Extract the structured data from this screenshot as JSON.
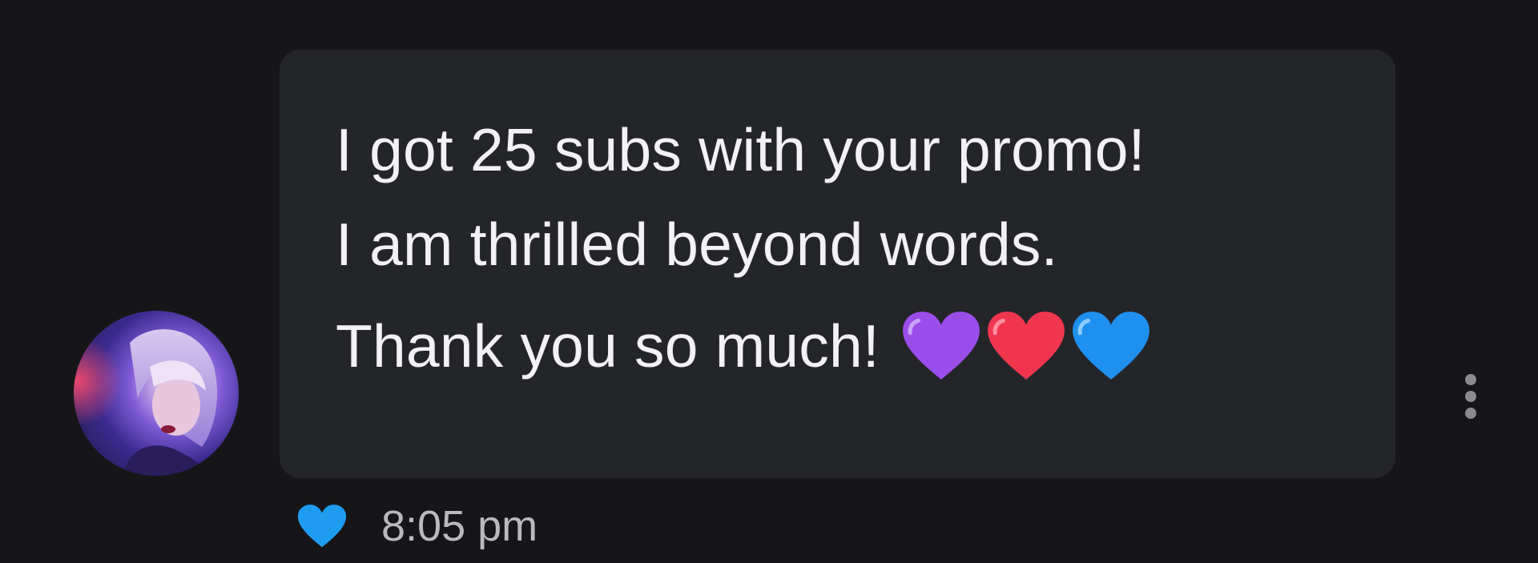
{
  "message": {
    "lines": [
      "I got 25 subs with your promo!",
      "I am thrilled beyond words.",
      "Thank you so much!"
    ],
    "emojis": [
      "purple-heart",
      "red-heart",
      "blue-heart"
    ],
    "timestamp": "8:05 pm",
    "reaction": "blue-heart"
  },
  "colors": {
    "background": "#161618",
    "bubble": "#242529",
    "message_text": "#f2f2f4",
    "timestamp_text": "#b9bac0",
    "reaction_heart": "#1e9cf0",
    "purple_heart": "#9b4dea",
    "red_heart": "#f0364f",
    "blue_heart": "#1e90f0"
  },
  "avatar": {
    "icon": "user-photo"
  },
  "menu": {
    "icon": "more-vertical-icon"
  }
}
